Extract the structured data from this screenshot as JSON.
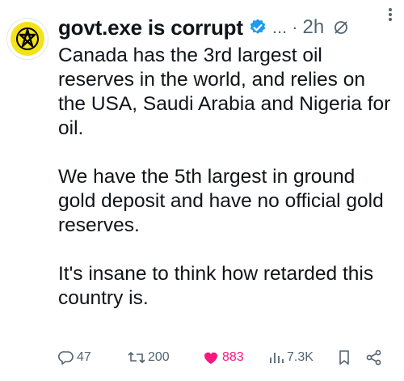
{
  "post": {
    "author_name": "govt.exe is corrupt",
    "handle_truncated": "...",
    "separator": "·",
    "time": "2h",
    "paragraphs": [
      "Canada has the 3rd largest oil reserves in the world, and relies on the USA, Saudi Arabia and Nigeria for oil.",
      "We have the 5th largest in ground gold deposit and have no official gold reserves.",
      "It's insane to think how retarded this country is."
    ]
  },
  "actions": {
    "replies": "47",
    "reposts": "200",
    "likes": "883",
    "views": "7.3K"
  },
  "colors": {
    "text": "#0f1419",
    "secondary": "#536471",
    "verified": "#1d9bf0",
    "like": "#f91880",
    "avatar_bg": "#f4e21a"
  },
  "icons": [
    "verified-badge-icon",
    "muted-icon",
    "more-icon",
    "reply-icon",
    "repost-icon",
    "like-icon",
    "views-icon",
    "bookmark-icon",
    "share-icon"
  ]
}
